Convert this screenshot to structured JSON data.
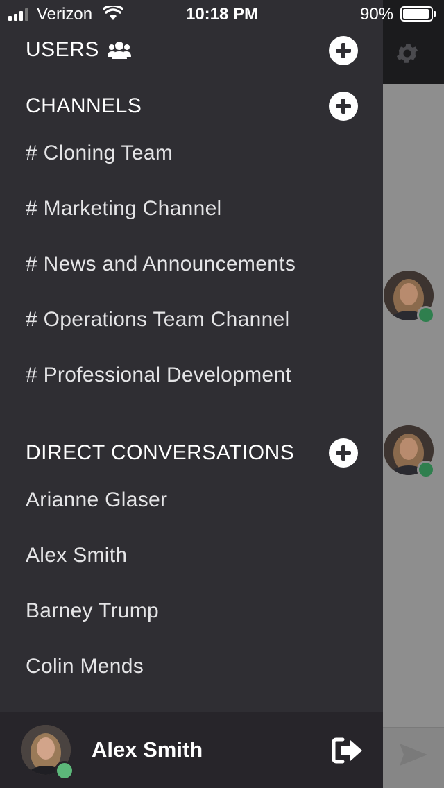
{
  "status_bar": {
    "carrier": "Verizon",
    "time": "10:18 PM",
    "battery_percent": "90%"
  },
  "drawer": {
    "users": {
      "label": "USERS",
      "icon": "users-icon",
      "add_icon": "plus-circle-icon"
    },
    "channels": {
      "label": "CHANNELS",
      "add_icon": "plus-circle-icon",
      "items": [
        {
          "label": "# Cloning Team"
        },
        {
          "label": "# Marketing Channel"
        },
        {
          "label": "# News and Announcements"
        },
        {
          "label": "# Operations Team Channel"
        },
        {
          "label": "# Professional Development"
        }
      ]
    },
    "direct_conversations": {
      "label": "DIRECT CONVERSATIONS",
      "add_icon": "plus-circle-icon",
      "items": [
        {
          "label": "Arianne Glaser"
        },
        {
          "label": "Alex Smith"
        },
        {
          "label": "Barney Trump"
        },
        {
          "label": "Colin Mends"
        }
      ]
    },
    "footer": {
      "user_name": "Alex Smith",
      "status": "online",
      "logout_icon": "sign-out-icon"
    }
  },
  "background": {
    "settings_icon": "gear-icon",
    "send_icon": "send-icon"
  },
  "colors": {
    "drawer_bg": "#2f2e33",
    "footer_bg": "#27252a",
    "online_status": "#5cb87a",
    "text": "#ffffff"
  }
}
